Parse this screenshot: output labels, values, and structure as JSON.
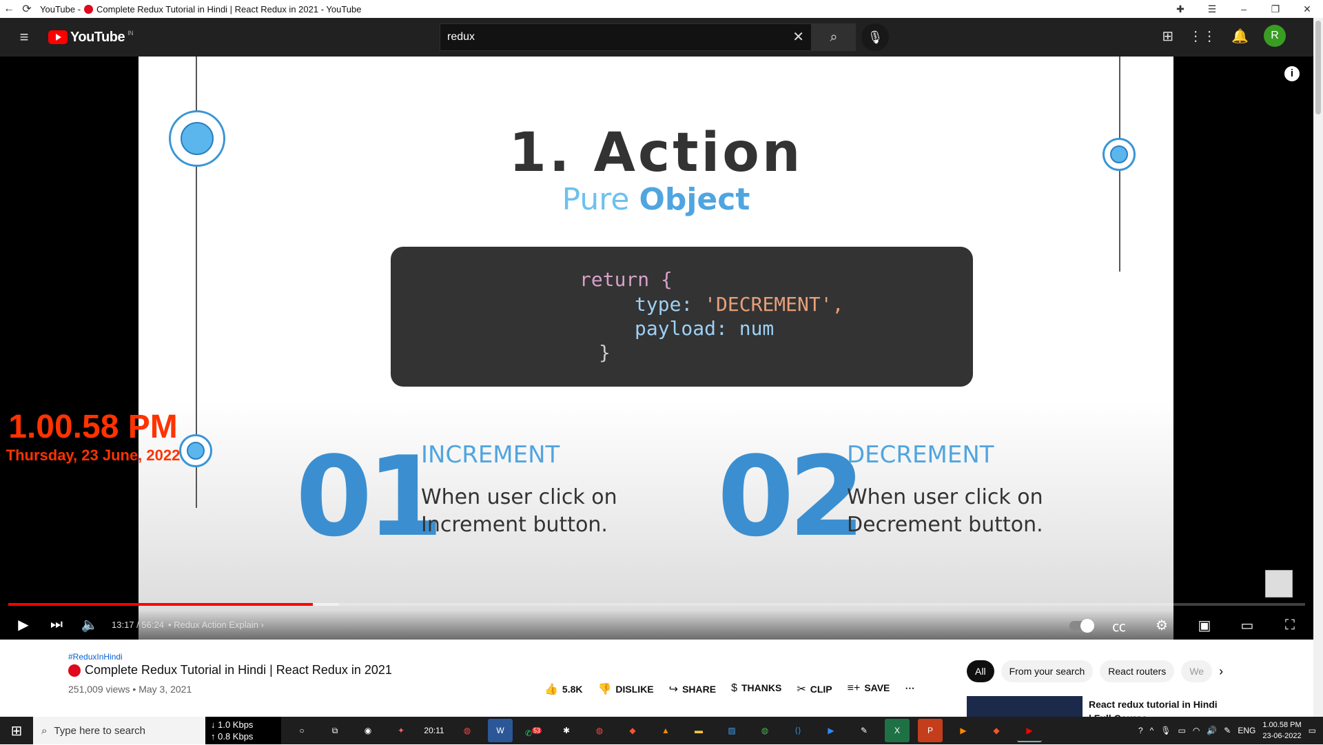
{
  "window": {
    "back_icon": "back-arrow-icon",
    "reload_icon": "reload-icon",
    "title_prefix": "YouTube -",
    "title": "Complete Redux Tutorial in Hindi | React Redux in 2021 - YouTube"
  },
  "header": {
    "logo_text": "YouTube",
    "logo_region": "IN",
    "search_value": "redux"
  },
  "slide": {
    "heading": "1. Action",
    "subheading_a": "Pure ",
    "subheading_b": "Object",
    "code": {
      "line1": "return {",
      "line2_key": "type:",
      "line2_val": "'DECREMENT',",
      "line3_key": "payload:",
      "line3_val": "num",
      "line4": "}"
    },
    "items": [
      {
        "number": "01",
        "title": "INCREMENT",
        "line1": "When user click on",
        "line2": "Increment button."
      },
      {
        "number": "02",
        "title": "DECREMENT",
        "line1": "When user click on",
        "line2": "Decrement button."
      }
    ]
  },
  "overlay_clock": {
    "time": "1.00.58 PM",
    "date": "Thursday, 23 June, 2022"
  },
  "player": {
    "current_time": "13:17",
    "separator": " / ",
    "duration": "56:24",
    "chapter": "• Redux Action Explain",
    "progress_fraction": 0.235,
    "buffered_fraction": 0.255
  },
  "video": {
    "hashtag": "#ReduxInHindi",
    "title": "Complete Redux Tutorial in Hindi | React Redux in 2021",
    "views": "251,009 views",
    "date": "May 3, 2021",
    "likes": "5.8K",
    "dislike_label": "DISLIKE",
    "share_label": "SHARE",
    "thanks_label": "THANKS",
    "clip_label": "CLIP",
    "save_label": "SAVE"
  },
  "chips": [
    "All",
    "From your search",
    "React routers",
    "We"
  ],
  "recommendation": {
    "title": "React redux tutorial in Hindi | Full Course"
  },
  "taskbar": {
    "search_placeholder": "Type here to search",
    "down_speed": "↓ 1.0 Kbps",
    "up_speed": "↑ 0.8 Kbps",
    "lang": "ENG",
    "time": "1.00.58 PM",
    "date": "23-06-2022",
    "badge": "53",
    "clock_app": "20:11"
  },
  "colors": {
    "accent_red": "#ff0000",
    "slide_blue": "#3b8fd0",
    "clock_orange": "#ff3300"
  }
}
